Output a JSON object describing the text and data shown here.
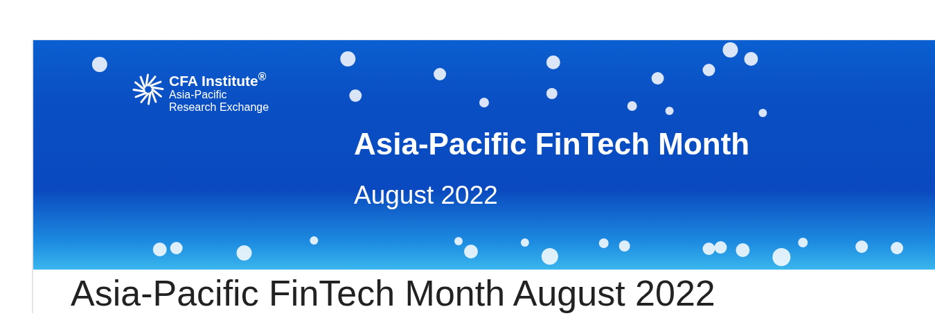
{
  "banner": {
    "logo": {
      "name": "CFA Institute$^{®}$",
      "lines": [
        "Asia-Pacific",
        "Research Exchange"
      ]
    },
    "title": "Asia-Pacific FinTech Month",
    "subtitle": "August 2022"
  },
  "article_title": "Asia-Pacific FinTech Month August 2022"
}
